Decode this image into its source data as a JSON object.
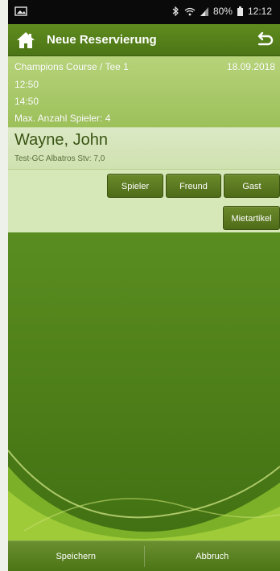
{
  "status_bar": {
    "battery": "80%",
    "time": "12:12",
    "left_icon": "image-icon",
    "icons": [
      "bluetooth-icon",
      "wifi-icon",
      "signal-icon",
      "battery-icon"
    ]
  },
  "app_bar": {
    "title": "Neue Reservierung",
    "left_icon": "home-icon",
    "right_icon": "back-arrow-icon"
  },
  "reservation": {
    "course": "Champions Course / Tee 1",
    "date": "18.09.2018",
    "start_time": "12:50",
    "end_time": "14:50",
    "max_players": "Max. Anzahl Spieler: 4"
  },
  "player": {
    "name": "Wayne, John",
    "club": "Test-GC Albatros Stv: 7,0",
    "buttons": {
      "spieler": "Spieler",
      "freund": "Freund",
      "gast": "Gast",
      "mietartikel": "Mietartikel"
    }
  },
  "footer": {
    "save": "Speichern",
    "cancel": "Abbruch"
  },
  "colors": {
    "brand_green": "#5c9022",
    "button_green": "#4e6b18",
    "info_bg": "#a9c96b",
    "card_bg": "#d6e8b7"
  }
}
